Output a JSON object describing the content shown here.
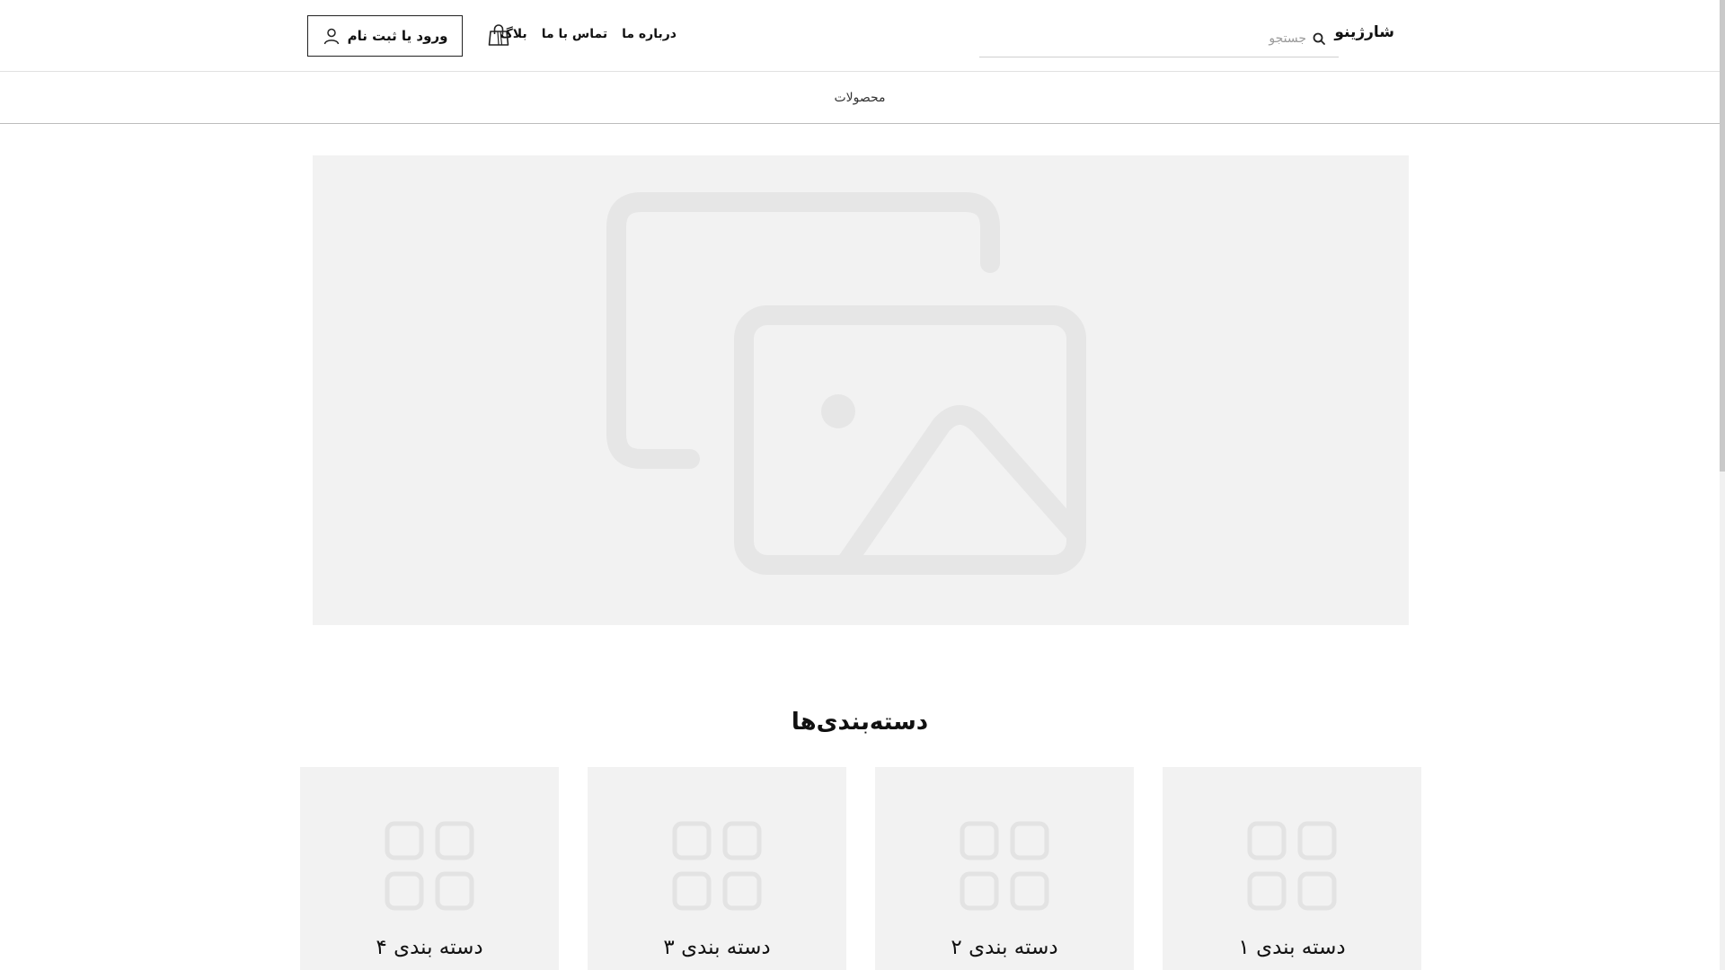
{
  "header": {
    "logo": "شارژینو",
    "search": {
      "placeholder": "جستجو",
      "icon": "search-icon"
    },
    "nav": [
      {
        "label": "درباره ما"
      },
      {
        "label": "تماس با ما"
      },
      {
        "label": "بلاگ"
      }
    ],
    "cart_icon": "shopping-bag-icon",
    "login": {
      "label": "ورود یا ثبت نام",
      "icon": "user-icon"
    }
  },
  "subnav": {
    "products": "محصولات"
  },
  "hero": {
    "icon": "image-placeholder-icon",
    "background": "#f2f2f2"
  },
  "categories": {
    "title": "دسته‌بندی‌ها",
    "items": [
      {
        "label": "دسته بندی ۱",
        "icon": "grid-icon"
      },
      {
        "label": "دسته بندی ۲",
        "icon": "grid-icon"
      },
      {
        "label": "دسته بندی ۳",
        "icon": "grid-icon"
      },
      {
        "label": "دسته بندی ۴",
        "icon": "grid-icon"
      }
    ]
  }
}
